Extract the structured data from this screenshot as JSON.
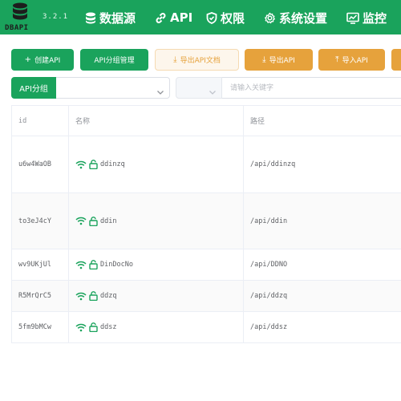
{
  "header": {
    "logo_text": "DBAPI",
    "version": "3.2.1",
    "nav": [
      {
        "label": "数据源",
        "icon": "database-icon"
      },
      {
        "label": "API",
        "icon": "link-icon"
      },
      {
        "label": "权限",
        "icon": "shield-icon"
      },
      {
        "label": "系统设置",
        "icon": "gear-icon"
      },
      {
        "label": "监控",
        "icon": "monitor-chart-icon"
      }
    ]
  },
  "toolbar": {
    "create_api": "创建API",
    "group_manage": "API分组管理",
    "export_doc": "导出API文档",
    "export_api": "导出API",
    "import_api": "导入API"
  },
  "search": {
    "group_label": "API分组",
    "keyword_placeholder": "请输入关键字"
  },
  "table": {
    "columns": {
      "id": "id",
      "name": "名称",
      "path": "路径"
    },
    "rows": [
      {
        "id": "u6w4WaOB",
        "name": "ddinzq",
        "path": "/api/ddinzq"
      },
      {
        "id": "to3eJ4cY",
        "name": "ddin",
        "path": "/api/ddin"
      },
      {
        "id": "wv9UKjUl",
        "name": "DinDocNo",
        "path": "/api/DDNO"
      },
      {
        "id": "R5MrQrC5",
        "name": "ddzq",
        "path": "/api/ddzq"
      },
      {
        "id": "5fm9bMCw",
        "name": "ddsz",
        "path": "/api/ddsz"
      }
    ]
  },
  "colors": {
    "primary": "#1aa35c",
    "warning": "#e6a23c"
  }
}
